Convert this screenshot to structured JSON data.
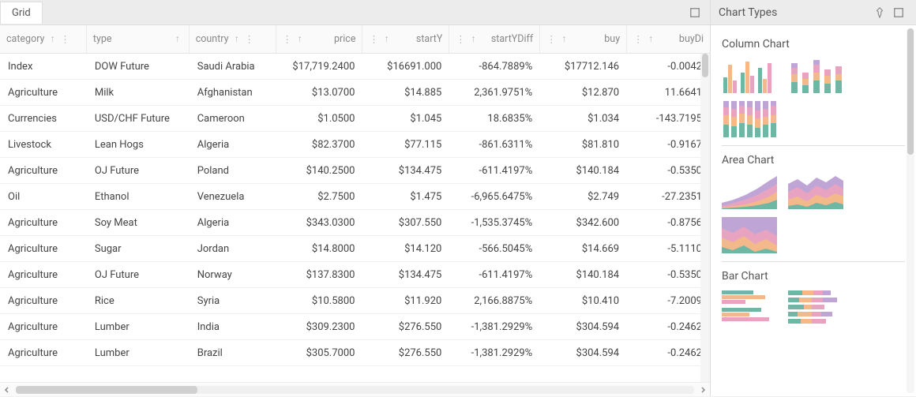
{
  "grid": {
    "tab_label": "Grid",
    "columns": [
      {
        "key": "category",
        "label": "category",
        "align": "left",
        "arrow": true,
        "kebab": true,
        "kebab_right": true
      },
      {
        "key": "type",
        "label": "type",
        "align": "left",
        "arrow": true,
        "kebab": false
      },
      {
        "key": "country",
        "label": "country",
        "align": "left",
        "arrow": true,
        "kebab": true,
        "kebab_right": true
      },
      {
        "key": "price",
        "label": "price",
        "align": "right",
        "arrow": true,
        "kebab": true
      },
      {
        "key": "startY",
        "label": "startY",
        "align": "right",
        "arrow": true,
        "kebab": true
      },
      {
        "key": "startYDiff",
        "label": "startYDiff",
        "align": "right",
        "arrow": true,
        "kebab": true
      },
      {
        "key": "buy",
        "label": "buy",
        "align": "right",
        "arrow": true,
        "kebab": true
      },
      {
        "key": "buyDi",
        "label": "buyDi",
        "align": "right",
        "arrow": true,
        "kebab": true
      }
    ],
    "rows": [
      {
        "category": "Index",
        "type": "DOW Future",
        "country": "Saudi Arabia",
        "price": "$17,719.2400",
        "startY": "$16691.000",
        "startYDiff": "-864.7889%",
        "buy": "$17712.146",
        "buyDi": "-0.0042"
      },
      {
        "category": "Agriculture",
        "type": "Milk",
        "country": "Afghanistan",
        "price": "$13.0700",
        "startY": "$14.885",
        "startYDiff": "2,361.9751%",
        "buy": "$12.870",
        "buyDi": "11.6641"
      },
      {
        "category": "Currencies",
        "type": "USD/CHF Future",
        "country": "Cameroon",
        "price": "$1.0500",
        "startY": "$1.045",
        "startYDiff": "18.6835%",
        "buy": "$1.034",
        "buyDi": "-143.7195"
      },
      {
        "category": "Livestock",
        "type": "Lean Hogs",
        "country": "Algeria",
        "price": "$82.3700",
        "startY": "$77.115",
        "startYDiff": "-861.6311%",
        "buy": "$81.810",
        "buyDi": "-0.9167"
      },
      {
        "category": "Agriculture",
        "type": "OJ Future",
        "country": "Poland",
        "price": "$140.2500",
        "startY": "$134.475",
        "startYDiff": "-611.4197%",
        "buy": "$140.184",
        "buyDi": "-0.5350"
      },
      {
        "category": "Oil",
        "type": "Ethanol",
        "country": "Venezuela",
        "price": "$2.7500",
        "startY": "$1.475",
        "startYDiff": "-6,965.6475%",
        "buy": "$2.749",
        "buyDi": "-27.2351"
      },
      {
        "category": "Agriculture",
        "type": "Soy Meat",
        "country": "Algeria",
        "price": "$343.0300",
        "startY": "$307.550",
        "startYDiff": "-1,535.3745%",
        "buy": "$342.600",
        "buyDi": "-0.8756"
      },
      {
        "category": "Agriculture",
        "type": "Sugar",
        "country": "Jordan",
        "price": "$14.8000",
        "startY": "$14.120",
        "startYDiff": "-566.5045%",
        "buy": "$14.669",
        "buyDi": "-5.1110"
      },
      {
        "category": "Agriculture",
        "type": "OJ Future",
        "country": "Norway",
        "price": "$137.8300",
        "startY": "$134.475",
        "startYDiff": "-611.4197%",
        "buy": "$140.184",
        "buyDi": "-0.5350"
      },
      {
        "category": "Agriculture",
        "type": "Rice",
        "country": "Syria",
        "price": "$10.5800",
        "startY": "$11.920",
        "startYDiff": "2,166.8875%",
        "buy": "$10.410",
        "buyDi": "-7.2009"
      },
      {
        "category": "Agriculture",
        "type": "Lumber",
        "country": "India",
        "price": "$309.2300",
        "startY": "$276.550",
        "startYDiff": "-1,381.2929%",
        "buy": "$304.594",
        "buyDi": "-0.2462"
      },
      {
        "category": "Agriculture",
        "type": "Lumber",
        "country": "Brazil",
        "price": "$305.7000",
        "startY": "$276.550",
        "startYDiff": "-1,381.2929%",
        "buy": "$304.594",
        "buyDi": "-0.2462"
      }
    ]
  },
  "charts_panel": {
    "title": "Chart Types",
    "sections": [
      {
        "title": "Column Chart"
      },
      {
        "title": "Area Chart"
      },
      {
        "title": "Bar Chart"
      }
    ]
  },
  "palette": {
    "teal": "#6fb7a5",
    "orange": "#f4b98a",
    "pink": "#e8a3c0",
    "purple": "#bfa5d6"
  }
}
